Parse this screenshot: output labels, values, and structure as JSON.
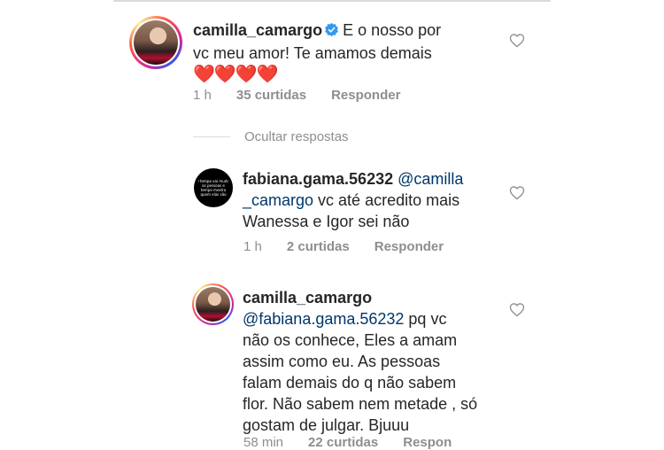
{
  "comments": [
    {
      "username": "camilla_camargo",
      "verified": true,
      "text_line1": "E o nosso por",
      "text_line2": "vc meu amor! Te amamos demais",
      "emoji": "❤️❤️❤️❤️",
      "time": "1 h",
      "likes": "35 curtidas",
      "reply": "Responder"
    }
  ],
  "replies_toggle": "Ocultar respostas",
  "replies": [
    {
      "username": "fabiana.gama.56232",
      "mention": "@camilla_camargo",
      "mention_part1": "@camilla",
      "mention_part2": "_camargo",
      "text_after_mention": " vc  até acredito mais",
      "text_line3": "Wanessa e  Igor  sei  não",
      "avatar_text": "O tempo vai mudar as pessoas e tempo mostra quem elas são",
      "time": "1 h",
      "likes": "2 curtidas",
      "reply": "Responder"
    },
    {
      "username": "camilla_camargo",
      "mention": "@fabiana.gama.56232",
      "text_after_mention": " pq vc",
      "lines": [
        "não os conhece, Eles a amam",
        "assim como eu. As pessoas",
        "falam demais do q não sabem",
        "flor. Não sabem nem metade , só",
        "gostam de julgar. Bjuuu"
      ],
      "time": "58 min",
      "likes": "22 curtidas",
      "reply": "Respon"
    }
  ],
  "icons": {
    "like": "heart-outline-icon",
    "verified": "verified-badge-icon"
  },
  "colors": {
    "username": "#262626",
    "mention": "#00376b",
    "meta": "#8e8e8e",
    "verified": "#3897f0",
    "heart_emoji": "#ed1c24"
  }
}
